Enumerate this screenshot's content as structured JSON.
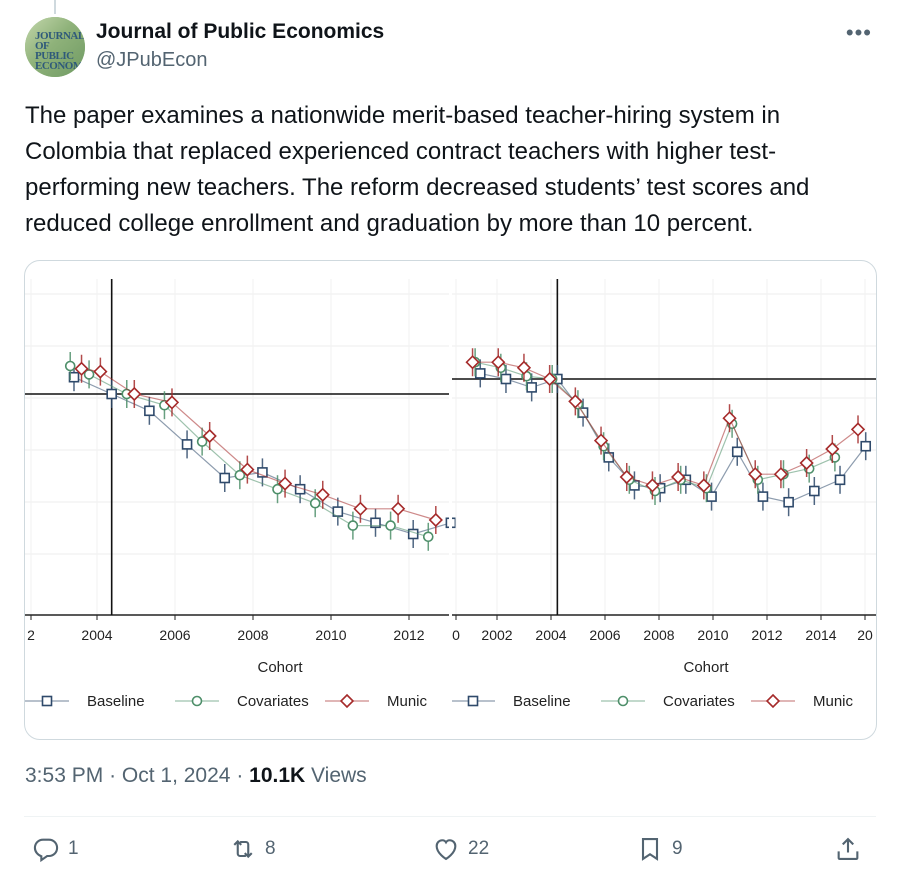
{
  "tweet": {
    "author_name": "Journal of Public Economics",
    "author_handle": "@JPubEcon",
    "avatar_text": "JOURNAL OF PUBLIC ECONOMICS",
    "more_label": "•••",
    "text": "The paper examines a nationwide merit-based teacher-hiring system in Colombia that replaced experienced contract teachers with higher test-performing new teachers. The reform decreased students’ test scores and reduced college enrollment and graduation by more than 10 percent.",
    "time": "3:53 PM",
    "date": "Oct 1, 2024",
    "views_count": "10.1K",
    "views_label": "Views"
  },
  "actions": {
    "reply_count": "1",
    "retweet_count": "8",
    "like_count": "22",
    "bookmark_count": "9"
  },
  "colors": {
    "baseline": "#2f4a6b",
    "covariates": "#4e8f6a",
    "municipality": "#a52a2a"
  },
  "chart_data": [
    {
      "type": "line",
      "xlabel": "Cohort",
      "x_ticks": [
        "2",
        "2004",
        "2006",
        "2008",
        "2010",
        "2012"
      ],
      "event_year": 2004,
      "series": [
        {
          "name": "Baseline",
          "marker": "square",
          "x": [
            2003,
            2004,
            2005,
            2006,
            2007,
            2008,
            2009,
            2010,
            2011,
            2012,
            2013
          ],
          "y": [
            0.6,
            0.0,
            -0.6,
            -1.8,
            -3.0,
            -2.8,
            -3.4,
            -4.2,
            -4.6,
            -5.0,
            -4.6
          ]
        },
        {
          "name": "Covariates",
          "marker": "circle",
          "x": [
            2002.9,
            2003.4,
            2004.4,
            2005.4,
            2006.4,
            2007.4,
            2008.4,
            2009.4,
            2010.4,
            2011.4,
            2012.4
          ],
          "y": [
            1.0,
            0.7,
            0.0,
            -0.4,
            -1.7,
            -2.9,
            -3.4,
            -3.9,
            -4.7,
            -4.7,
            -5.1
          ]
        },
        {
          "name": "Munic",
          "marker": "diamond",
          "x": [
            2003.2,
            2003.7,
            2004.6,
            2005.6,
            2006.6,
            2007.6,
            2008.6,
            2009.6,
            2010.6,
            2011.6,
            2012.6
          ],
          "y": [
            0.9,
            0.8,
            0.0,
            -0.3,
            -1.5,
            -2.7,
            -3.2,
            -3.6,
            -4.1,
            -4.1,
            -4.5
          ]
        }
      ],
      "legend": [
        "Baseline",
        "Covariates",
        "Munic"
      ],
      "legend_position": "bottom"
    },
    {
      "type": "line",
      "xlabel": "Cohort",
      "x_ticks": [
        "0",
        "2002",
        "2004",
        "2006",
        "2008",
        "2010",
        "2012",
        "2014",
        "20"
      ],
      "event_year": 2004,
      "series": [
        {
          "name": "Baseline",
          "marker": "square",
          "x": [
            2001,
            2002,
            2003,
            2004,
            2005,
            2006,
            2007,
            2008,
            2009,
            2010,
            2011,
            2012,
            2013,
            2014,
            2015,
            2016
          ],
          "y": [
            0.2,
            0.0,
            -0.3,
            0.0,
            -1.2,
            -2.8,
            -3.8,
            -3.9,
            -3.6,
            -4.2,
            -2.6,
            -4.2,
            -4.4,
            -4.0,
            -3.6,
            -2.4
          ]
        },
        {
          "name": "Covariates",
          "marker": "circle",
          "x": [
            2000.8,
            2001.8,
            2002.8,
            2003.8,
            2004.8,
            2005.8,
            2006.8,
            2007.8,
            2008.8,
            2009.8,
            2010.8,
            2011.8,
            2012.8,
            2013.8,
            2014.8
          ],
          "y": [
            0.6,
            0.4,
            0.1,
            0.0,
            -0.9,
            -2.4,
            -3.6,
            -4.0,
            -3.6,
            -3.9,
            -1.6,
            -3.6,
            -3.4,
            -3.2,
            -2.8
          ]
        },
        {
          "name": "Munic",
          "marker": "diamond",
          "x": [
            2000.7,
            2001.7,
            2002.7,
            2003.7,
            2004.7,
            2005.7,
            2006.7,
            2007.7,
            2008.7,
            2009.7,
            2010.7,
            2011.7,
            2012.7,
            2013.7,
            2014.7,
            2015.7
          ],
          "y": [
            0.6,
            0.6,
            0.4,
            0.0,
            -0.8,
            -2.2,
            -3.5,
            -3.8,
            -3.5,
            -3.8,
            -1.4,
            -3.4,
            -3.4,
            -3.0,
            -2.5,
            -1.8
          ]
        }
      ],
      "legend": [
        "Baseline",
        "Covariates",
        "Munic"
      ],
      "legend_position": "bottom"
    }
  ]
}
